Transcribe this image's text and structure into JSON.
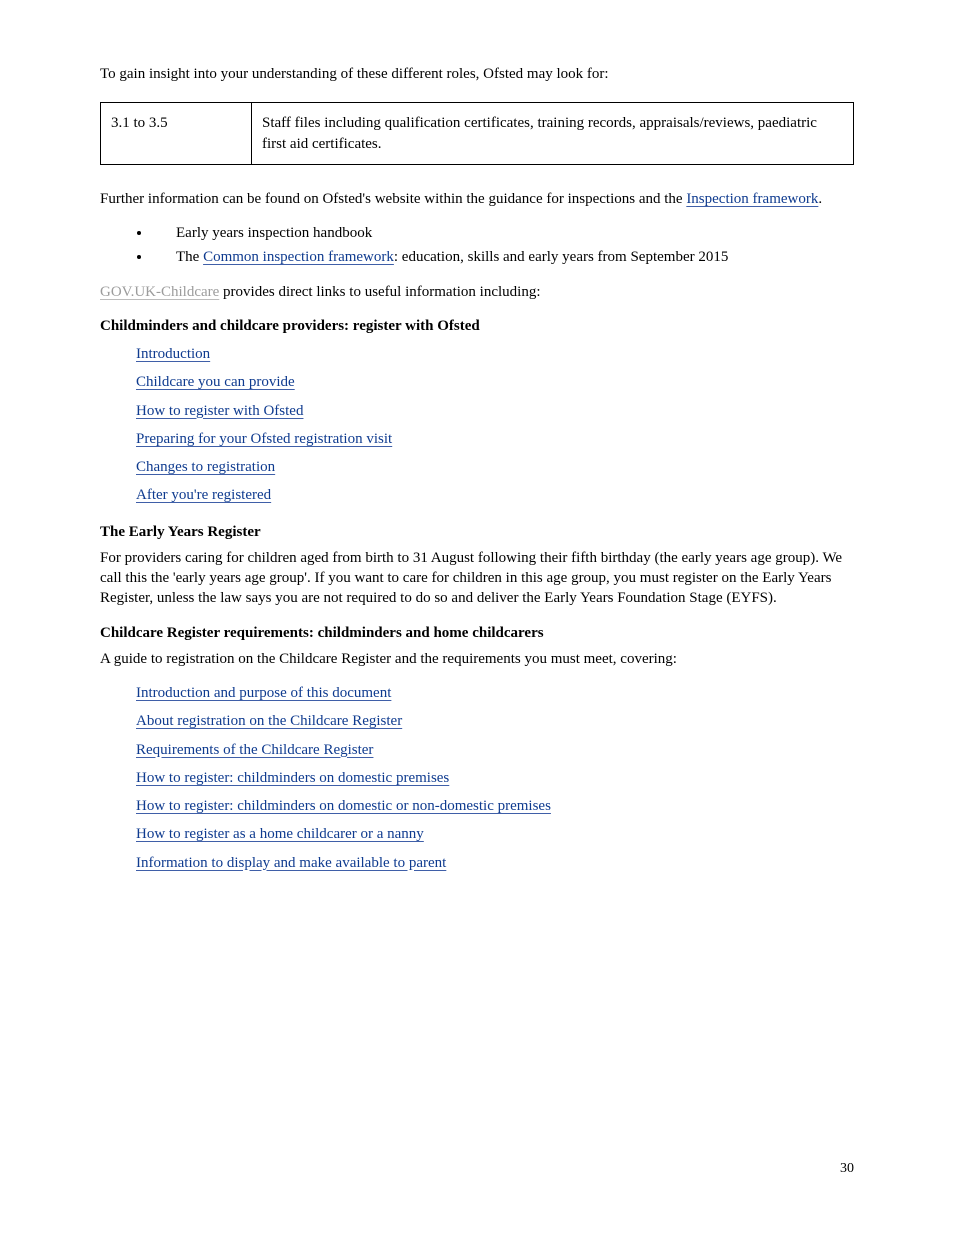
{
  "lead": "To gain insight into your understanding of these different roles, Ofsted may look for:",
  "table": {
    "col_a": "3.1 to 3.5",
    "col_b": "Staff files including qualification certificates, training records, appraisals/reviews, paediatric first aid certificates."
  },
  "p_brief1": "Further information can be found on Ofsted's website within the guidance for inspections and the",
  "link_framework": "Inspection framework",
  "p_brief1_tail": ".",
  "bullets": {
    "b1": "Early years inspection handbook",
    "b2_pre": "The ",
    "b2_link": "Common inspection framework",
    "b2_post": ": education, skills and early years from September 2015"
  },
  "link_gov_childcare": "GOV.UK-Childcare",
  "p_gov_tail": " provides direct links to useful information including:",
  "section_a": {
    "head": "Childminders and childcare providers: register with Ofsted",
    "links": [
      "Introduction",
      "Childcare you can provide",
      "How to register with Ofsted",
      "Preparing for your Ofsted registration visit",
      "Changes to registration",
      "After you're registered"
    ]
  },
  "section_b": {
    "head": "The Early Years Register",
    "body": "For providers caring for children aged from birth to 31 August following their fifth birthday (the early years age group). We call this the 'early years age group'. If you want to care for children in this age group, you must register on the Early Years Register, unless the law says you are not required to do so and deliver the Early Years Foundation Stage (EYFS)."
  },
  "section_c": {
    "head": "Childcare Register requirements: childminders and home childcarers",
    "body": "A guide to registration on the Childcare Register and the requirements you must meet, covering:",
    "links": [
      "Introduction and purpose of this document",
      "About registration on the Childcare Register",
      "Requirements of the Childcare Register",
      "How to register: childminders on domestic premises",
      "How to register: childminders on domestic or non-domestic premises",
      "How to register as a home childcarer or a nanny",
      "Information to display and make available to parent"
    ]
  },
  "page_number": "30"
}
